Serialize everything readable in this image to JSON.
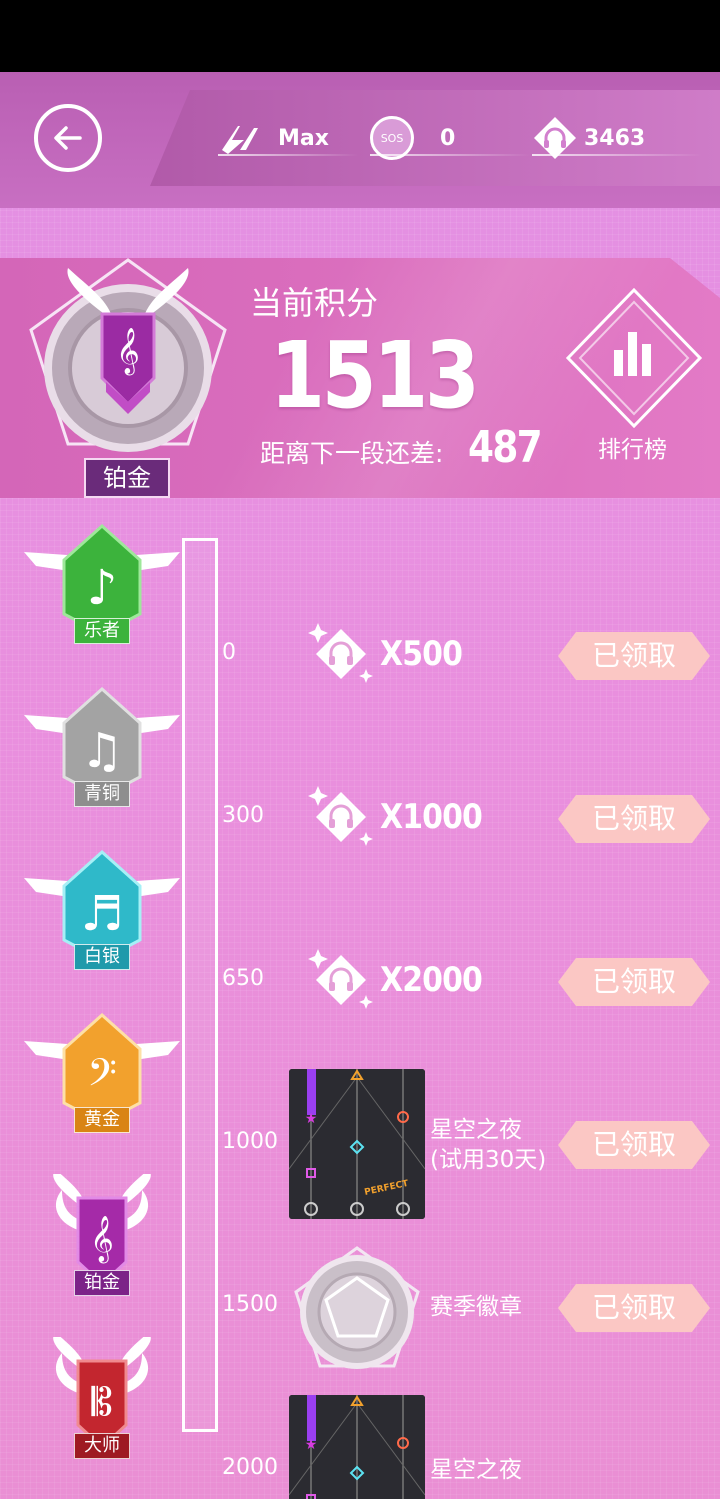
{
  "header": {
    "max_label": "Max",
    "sos_icon_text": "SOS",
    "sos_value": "0",
    "coins_value": "3463"
  },
  "score": {
    "title": "当前积分",
    "value": "1513",
    "diff_label": "距离下一段还差:",
    "diff_value": "487",
    "current_tier": "铂金",
    "leaderboard_label": "排行榜"
  },
  "tiers": [
    {
      "name": "乐者",
      "threshold": "0",
      "reward_amount": "X500",
      "status": "已领取",
      "color": "#3cb33c"
    },
    {
      "name": "青铜",
      "threshold": "300",
      "reward_amount": "X1000",
      "status": "已领取",
      "color": "#a3a3a3"
    },
    {
      "name": "白银",
      "threshold": "650",
      "reward_amount": "X2000",
      "status": "已领取",
      "color": "#2fb9c9"
    },
    {
      "name": "黄金",
      "threshold": "1000",
      "reward_text": "星空之夜\n(试用30天)",
      "status": "已领取",
      "color": "#f2a12d"
    },
    {
      "name": "铂金",
      "threshold": "1500",
      "reward_text": "赛季徽章",
      "status": "已领取",
      "color": "#a52aa8"
    },
    {
      "name": "大师",
      "threshold": "2000",
      "reward_text": "星空之夜",
      "status": "",
      "color": "#c3262f"
    }
  ],
  "thumb_text": "PERFECT",
  "colors": {
    "claim_button": "#fbc7c4",
    "panel": "#d466b8",
    "background": "#e391e4"
  }
}
